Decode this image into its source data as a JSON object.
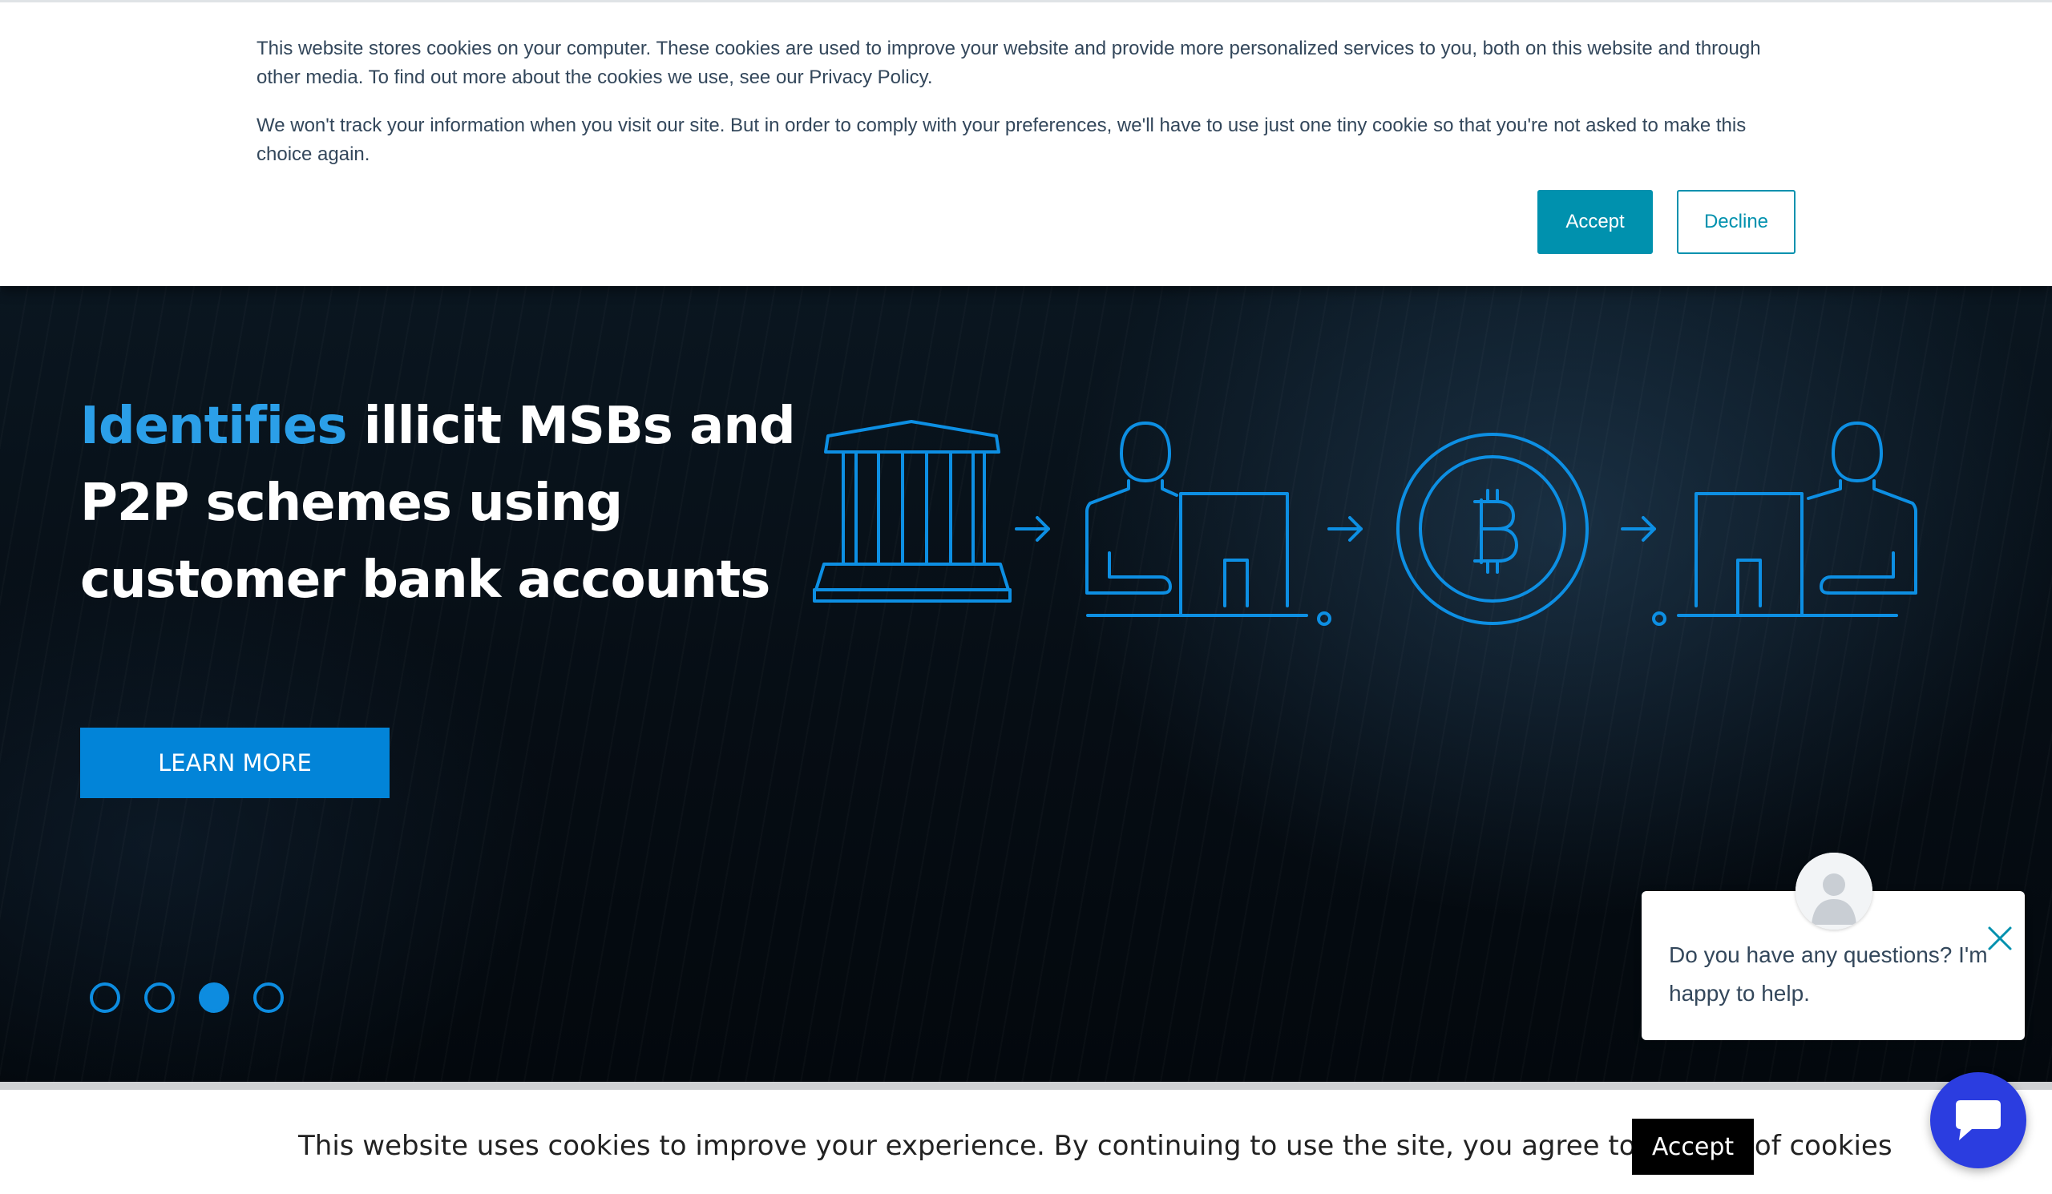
{
  "cookie_banner": {
    "paragraph_1": "This website stores cookies on your computer. These cookies are used to improve your website and provide more personalized services to you, both on this website and through other media. To find out more about the cookies we use, see our Privacy Policy.",
    "paragraph_2": "We won't track your information when you visit our site. But in order to comply with your preferences, we'll have to use just one tiny cookie so that you're not asked to make this choice again.",
    "accept_label": "Accept",
    "decline_label": "Decline",
    "accent_color": "#0091ae"
  },
  "hero": {
    "title_highlight": "Identifies",
    "title_rest": " illicit MSBs and P2P schemes using customer bank accounts",
    "cta_label": "LEARN MORE",
    "accent_color": "#2b9fe8",
    "diagram_icons": [
      "bank-icon",
      "arrow-right-icon",
      "person-at-computer-icon",
      "arrow-right-icon",
      "bitcoin-coin-icon",
      "arrow-right-icon",
      "computer-with-person-icon"
    ],
    "carousel": {
      "slide_count": 4,
      "active_slide": 3
    }
  },
  "bottom_cookie_bar": {
    "text": "This website uses cookies to improve your experience. By continuing to use the site, you agree to the use of cookies",
    "accept_label": "Accept"
  },
  "chat": {
    "message": "Do you have any questions? I'm happy to help.",
    "launcher_color": "#2b3de0",
    "icons": [
      "avatar-icon",
      "close-icon",
      "chat-icon"
    ]
  }
}
